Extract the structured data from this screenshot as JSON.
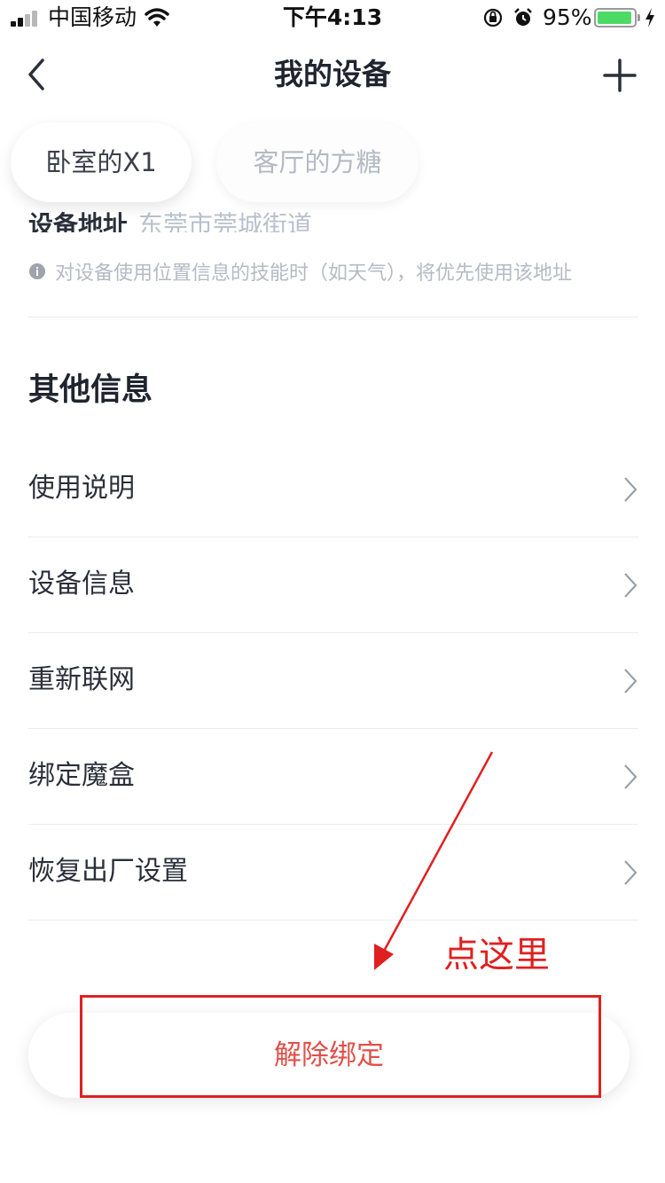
{
  "status_bar": {
    "carrier": "中国移动",
    "time": "下午4:13",
    "battery_percent": "95%",
    "battery_level": 0.95
  },
  "nav": {
    "title": "我的设备"
  },
  "device_tabs": [
    {
      "label": "卧室的X1",
      "active": true
    },
    {
      "label": "客厅的方糖",
      "active": false
    }
  ],
  "address": {
    "label": "设备地址",
    "value": "东莞市莞城街道",
    "hint": "对设备使用位置信息的技能时（如天气），将优先使用该地址"
  },
  "other_info": {
    "title": "其他信息",
    "items": [
      {
        "label": "使用说明"
      },
      {
        "label": "设备信息"
      },
      {
        "label": "重新联网"
      },
      {
        "label": "绑定魔盒"
      },
      {
        "label": "恢复出厂设置"
      }
    ]
  },
  "unbind_button": {
    "label": "解除绑定"
  },
  "annotation": {
    "text": "点这里",
    "color": "#e02020"
  },
  "colors": {
    "accent_red": "#e0504a",
    "battery_green": "#4cd964",
    "muted_text": "#b5bac6"
  }
}
